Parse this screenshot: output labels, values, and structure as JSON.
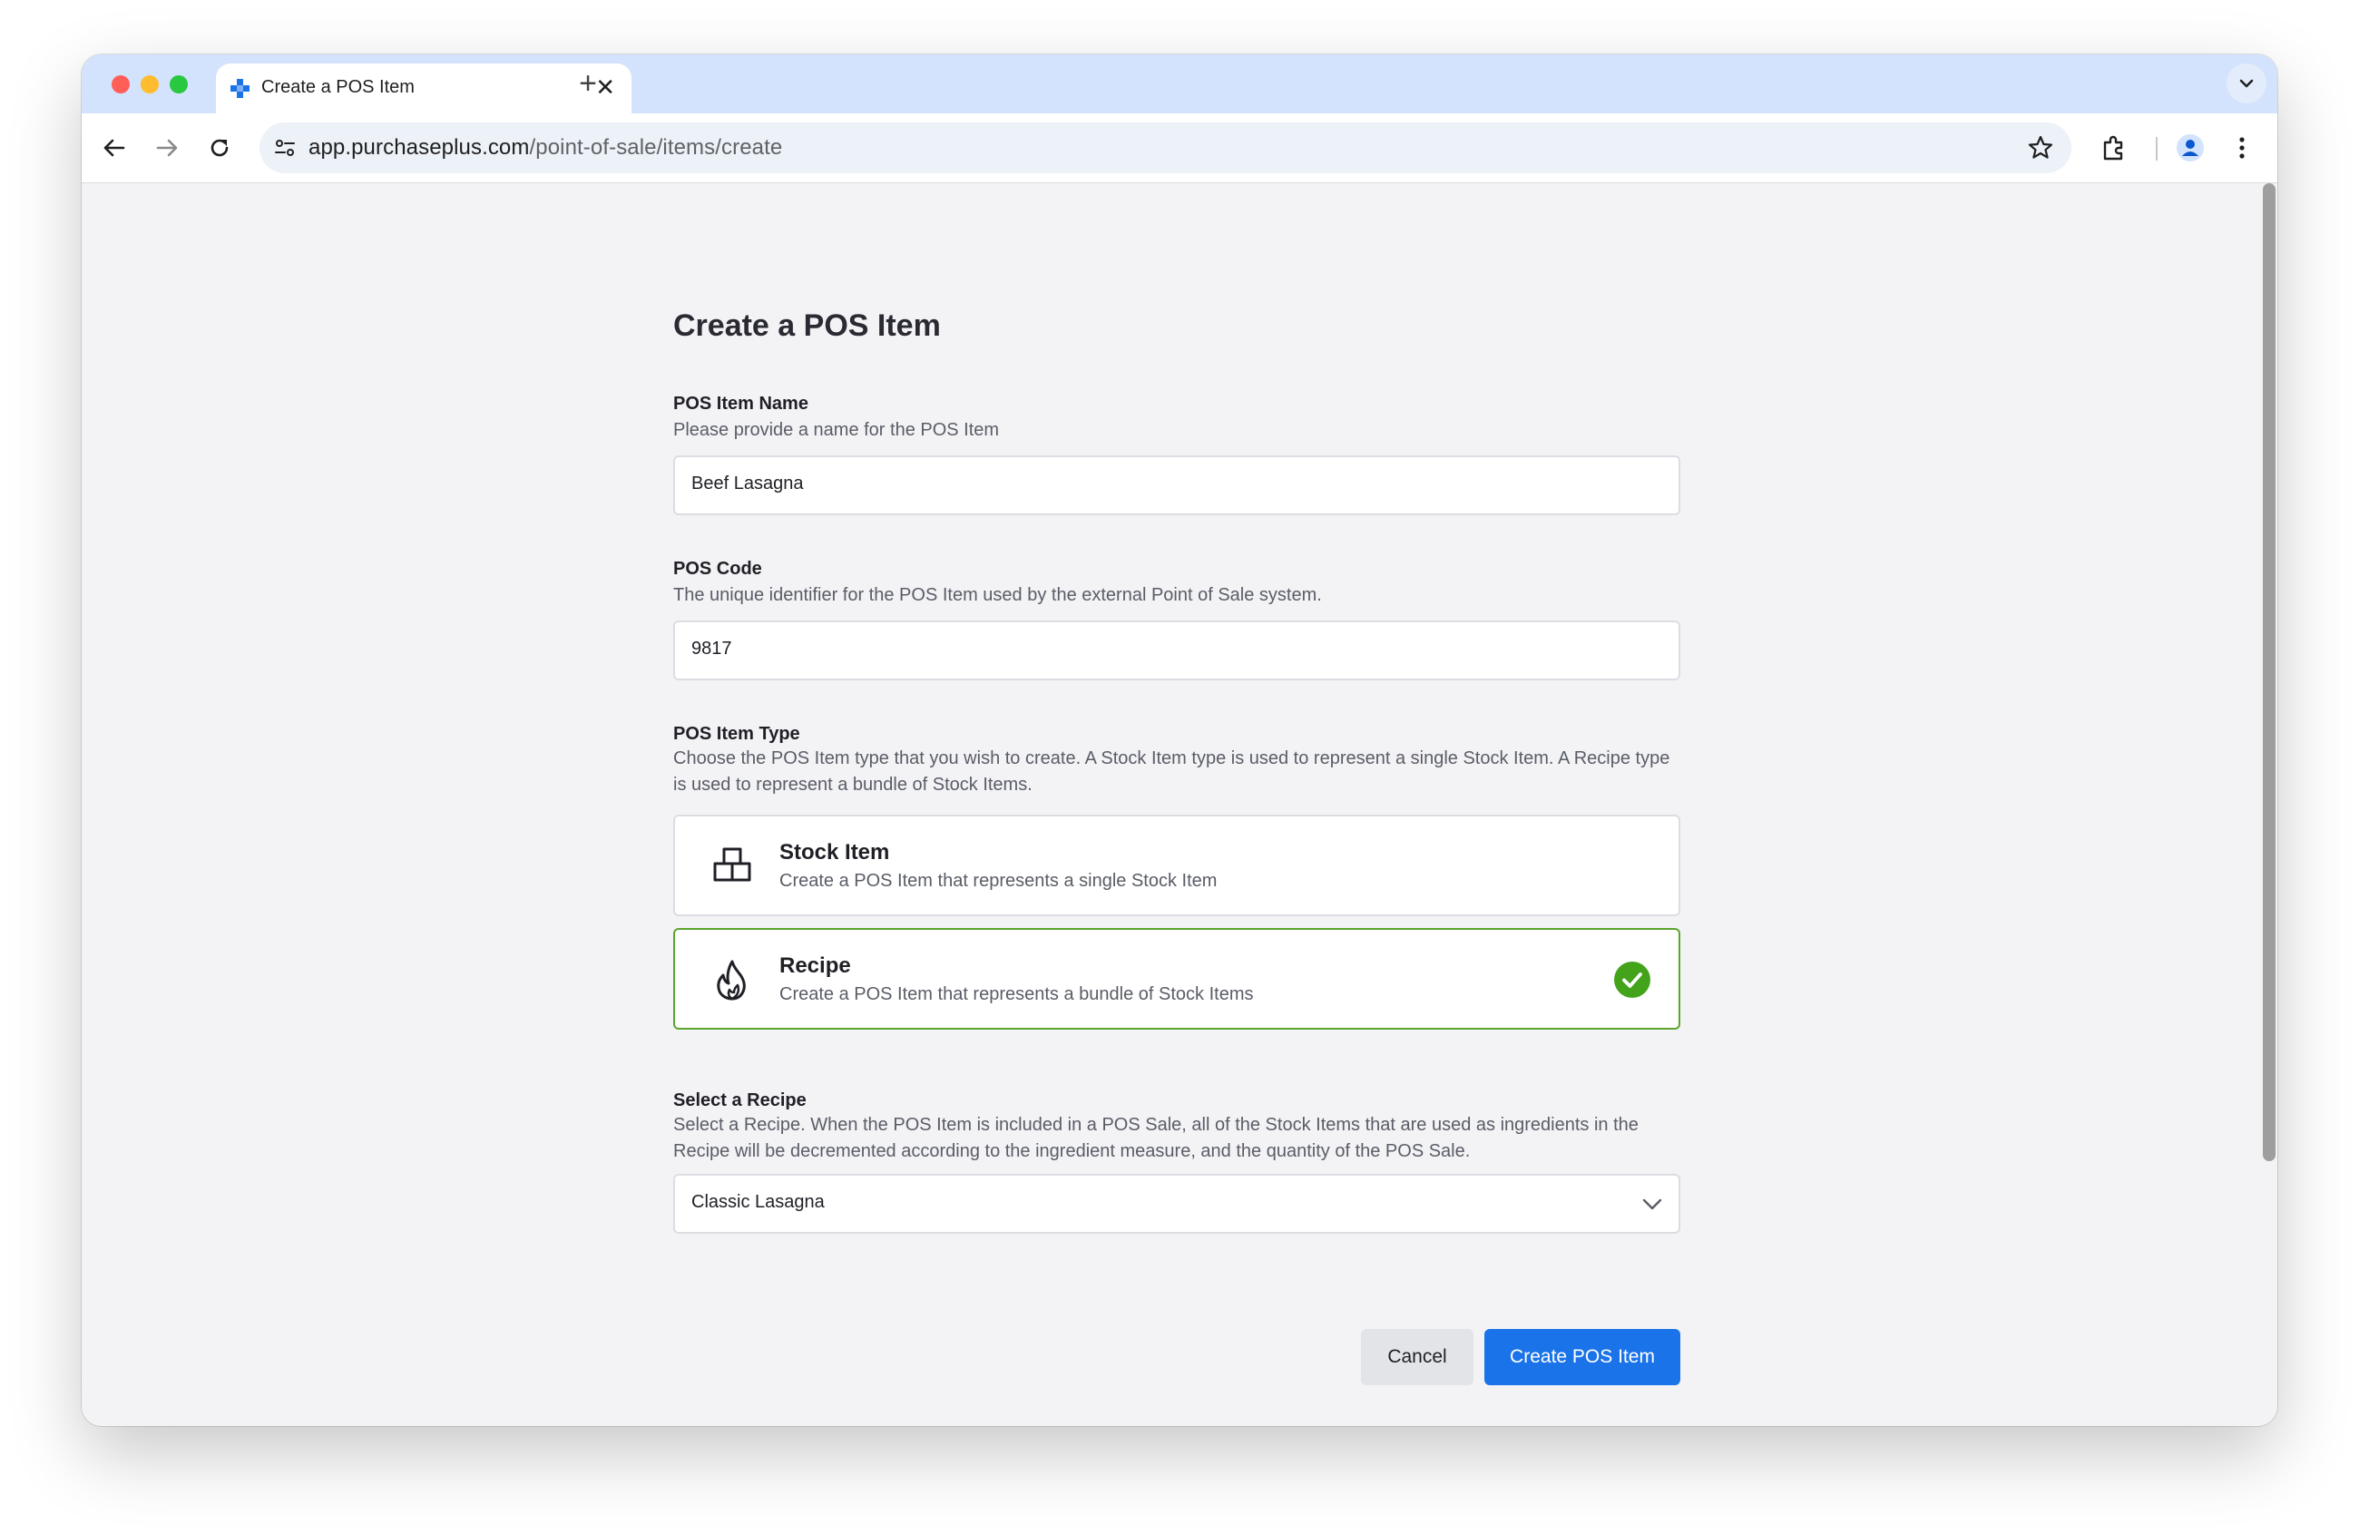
{
  "browser": {
    "tab_title": "Create a POS Item",
    "tab_close": "✕",
    "new_tab": "+",
    "url_host": "app.purchaseplus.com",
    "url_path": "/point-of-sale/items/create"
  },
  "page": {
    "title": "Create a POS Item",
    "name_field": {
      "label": "POS Item Name",
      "description": "Please provide a name for the POS Item",
      "value": "Beef Lasagna"
    },
    "code_field": {
      "label": "POS Code",
      "description": "The unique identifier for the POS Item used by the external Point of Sale system.",
      "value": "9817"
    },
    "type_field": {
      "label": "POS Item Type",
      "description": "Choose the POS Item type that you wish to create. A Stock Item type is used to represent a single Stock Item. A Recipe type is used to represent a bundle of Stock Items.",
      "options": [
        {
          "title": "Stock Item",
          "description": "Create a POS Item that represents a single Stock Item",
          "icon": "boxes-icon",
          "selected": false
        },
        {
          "title": "Recipe",
          "description": "Create a POS Item that represents a bundle of Stock Items",
          "icon": "flame-icon",
          "selected": true
        }
      ]
    },
    "recipe_field": {
      "label": "Select a Recipe",
      "description": "Select a Recipe. When the POS Item is included in a POS Sale, all of the Stock Items that are used as ingredients in the Recipe will be decremented according to the ingredient measure, and the quantity of the POS Sale.",
      "value": "Classic Lasagna"
    },
    "actions": {
      "cancel": "Cancel",
      "submit": "Create POS Item"
    }
  },
  "colors": {
    "accent": "#1a73e8",
    "selected_border": "#5aa52c",
    "check_green": "#43a41c",
    "tabbar": "#d3e3fd"
  }
}
